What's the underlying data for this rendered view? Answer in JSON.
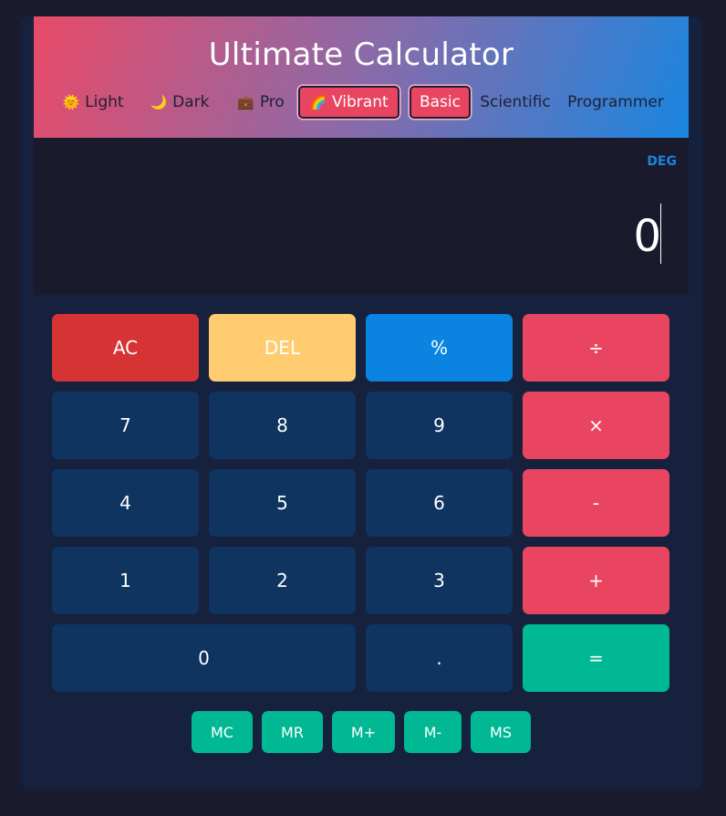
{
  "app": {
    "title": "Ultimate Calculator"
  },
  "themes": [
    {
      "icon": "🌞",
      "label": "Light"
    },
    {
      "icon": "🌙",
      "label": "Dark"
    },
    {
      "icon": "💼",
      "label": "Pro"
    },
    {
      "icon": "🌈",
      "label": "Vibrant",
      "active": true
    }
  ],
  "modes": [
    {
      "label": "Basic",
      "active": true
    },
    {
      "label": "Scientific"
    },
    {
      "label": "Programmer"
    }
  ],
  "display": {
    "angle_unit": "DEG",
    "value": "0"
  },
  "keypad": {
    "ac": "AC",
    "del": "DEL",
    "percent": "%",
    "divide": "÷",
    "seven": "7",
    "eight": "8",
    "nine": "9",
    "multiply": "×",
    "four": "4",
    "five": "5",
    "six": "6",
    "minus": "-",
    "one": "1",
    "two": "2",
    "three": "3",
    "plus": "+",
    "zero": "0",
    "dot": ".",
    "equals": "="
  },
  "memory": [
    "MC",
    "MR",
    "M+",
    "M-",
    "MS"
  ],
  "colors": {
    "background": "#1a1b2e",
    "panel": "#16213e",
    "number_key": "#0f3460",
    "operator_key": "#e94560",
    "clear_key": "#d63434",
    "delete_key": "#ffcc70",
    "percent_key": "#0a84e0",
    "equals_key": "#00b894",
    "memory_key": "#00b894",
    "accent": "#1a86e0"
  }
}
